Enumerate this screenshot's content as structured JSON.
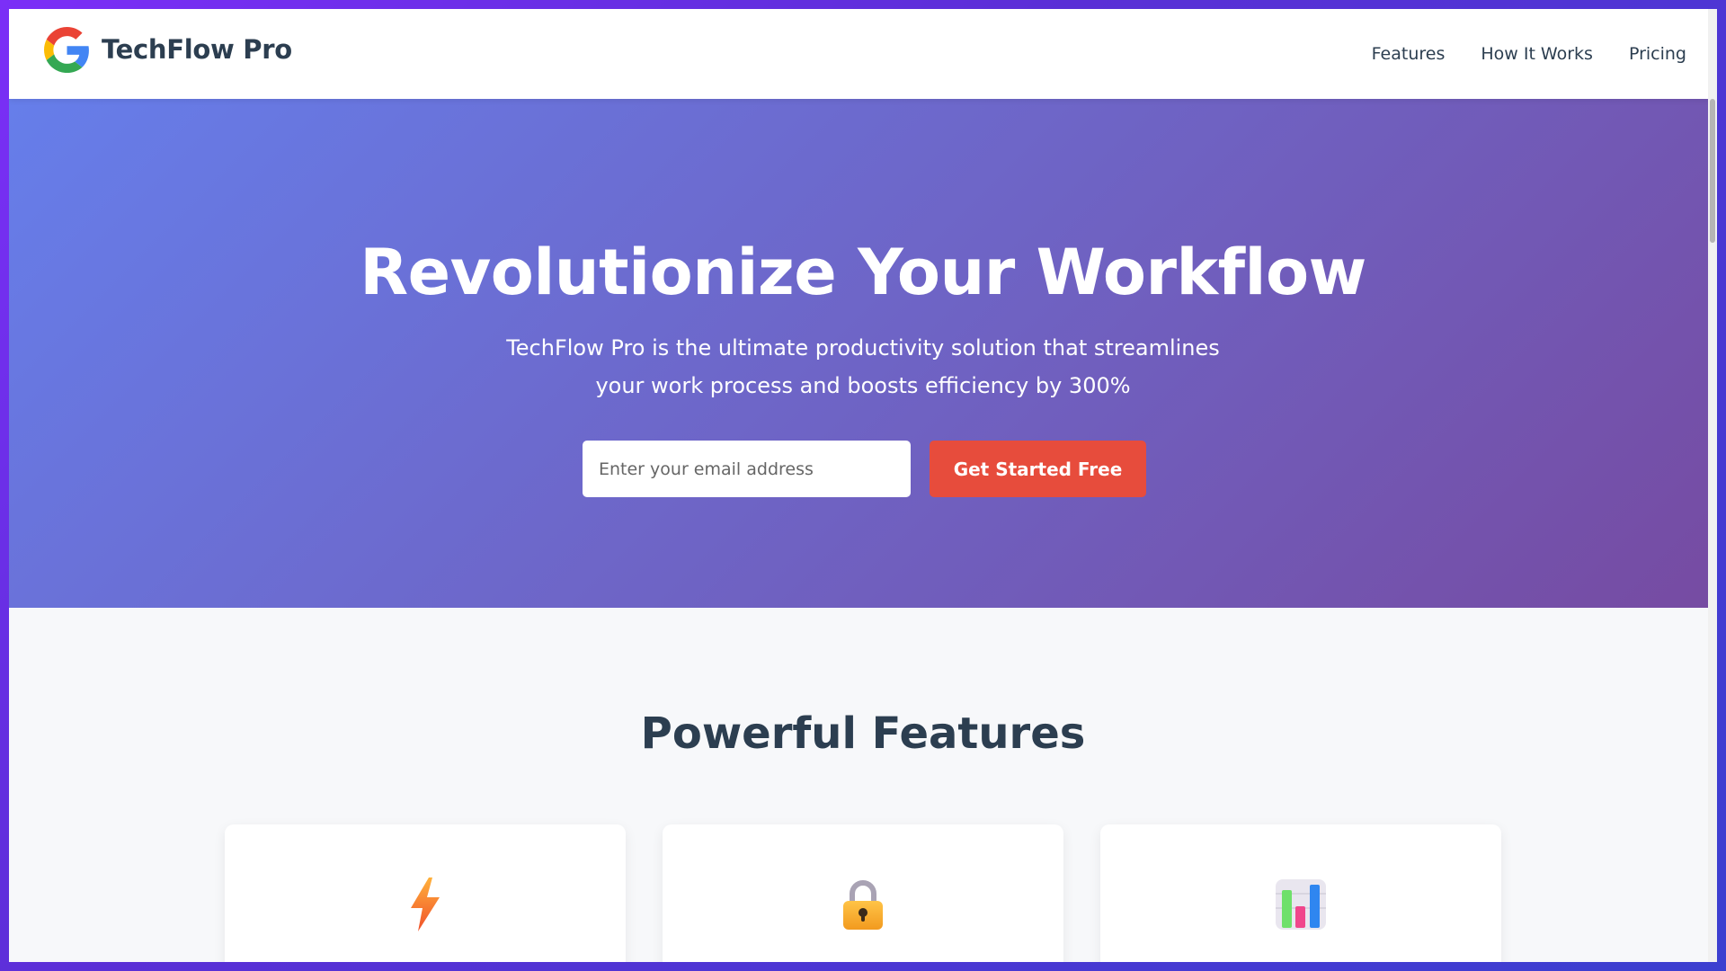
{
  "header": {
    "brand": "TechFlow Pro",
    "logo_icon": "google-g-icon",
    "nav": [
      {
        "label": "Features"
      },
      {
        "label": "How It Works"
      },
      {
        "label": "Pricing"
      }
    ]
  },
  "hero": {
    "title": "Revolutionize Your Workflow",
    "subtitle": "TechFlow Pro is the ultimate productivity solution that streamlines your work process and boosts efficiency by 300%",
    "email_placeholder": "Enter your email address",
    "email_value": "",
    "cta_label": "Get Started Free"
  },
  "features": {
    "heading": "Powerful Features",
    "cards": [
      {
        "icon": "lightning-icon"
      },
      {
        "icon": "lock-icon"
      },
      {
        "icon": "bar-chart-icon"
      }
    ]
  },
  "colors": {
    "hero_gradient_start": "#667eea",
    "hero_gradient_end": "#764ba2",
    "cta": "#e74c3c",
    "heading": "#2c3e50"
  }
}
